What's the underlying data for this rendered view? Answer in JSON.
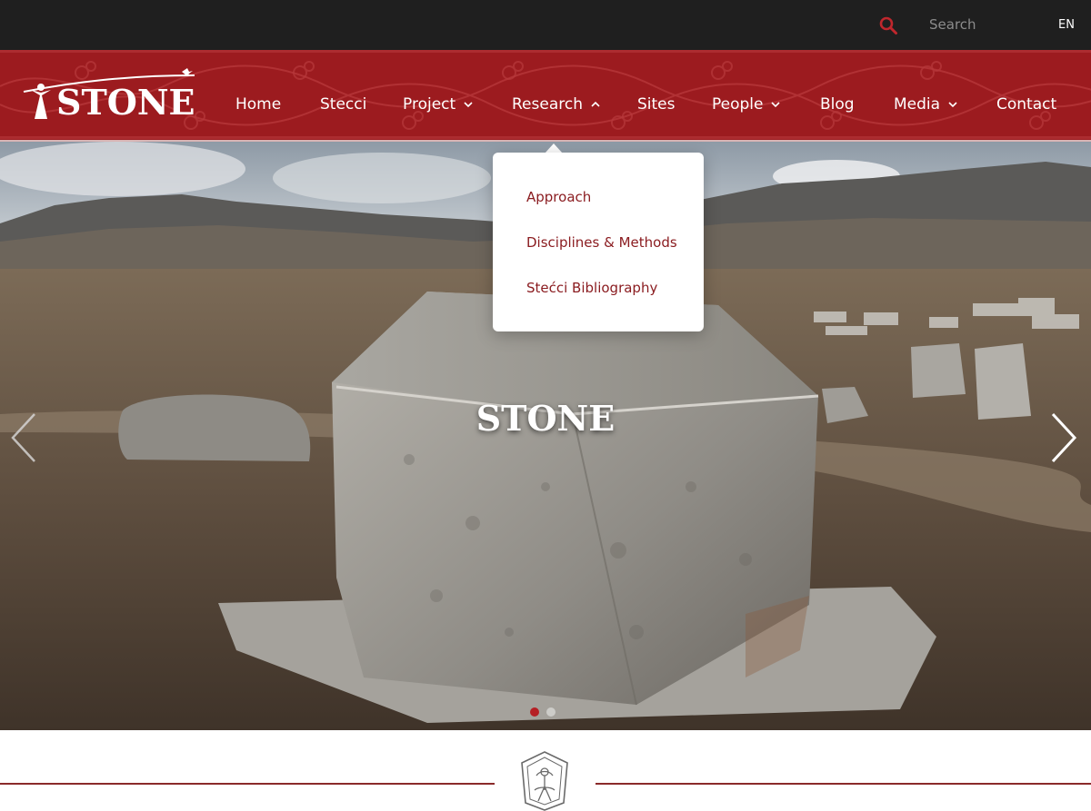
{
  "topbar": {
    "search": {
      "placeholder": "Search",
      "icon": "search-icon"
    },
    "language": "EN"
  },
  "header": {
    "logo_text": "STONE",
    "nav": [
      {
        "label": "Home",
        "has_dropdown": false
      },
      {
        "label": "Stecci",
        "has_dropdown": false
      },
      {
        "label": "Project",
        "has_dropdown": true,
        "expanded": false
      },
      {
        "label": "Research",
        "has_dropdown": true,
        "expanded": true
      },
      {
        "label": "Sites",
        "has_dropdown": false
      },
      {
        "label": "People",
        "has_dropdown": true,
        "expanded": false
      },
      {
        "label": "Blog",
        "has_dropdown": false
      },
      {
        "label": "Media",
        "has_dropdown": true,
        "expanded": false
      },
      {
        "label": "Contact",
        "has_dropdown": false
      }
    ]
  },
  "research_dropdown": {
    "items": [
      "Approach",
      "Disciplines & Methods",
      "Stećci Bibliography"
    ]
  },
  "hero": {
    "title": "STONE",
    "slide_count": 2,
    "active_slide": 1
  },
  "colors": {
    "topbar_bg": "#1f1f1f",
    "brand_red": "#9c1b1f",
    "dropdown_text": "#8a1b1f",
    "active_dot": "#b51f24"
  }
}
